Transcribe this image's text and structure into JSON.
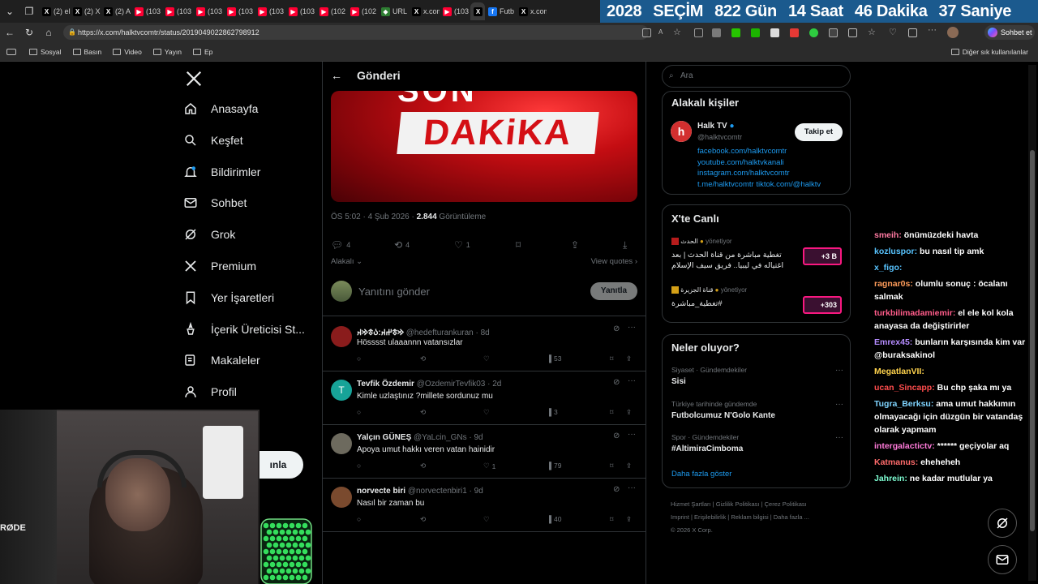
{
  "browser": {
    "tabs": [
      {
        "label": "(2) el",
        "icon": "x-logo-icon",
        "color": "#000000"
      },
      {
        "label": "(2) X",
        "icon": "x-logo-icon",
        "color": "#000000"
      },
      {
        "label": "(2) A",
        "icon": "x-logo-icon",
        "color": "#000000"
      },
      {
        "label": "(103",
        "icon": "youtube-icon",
        "color": "#ff0033"
      },
      {
        "label": "(103",
        "icon": "youtube-icon",
        "color": "#ff0033"
      },
      {
        "label": "(103",
        "icon": "youtube-icon",
        "color": "#ff0033"
      },
      {
        "label": "(103",
        "icon": "youtube-icon",
        "color": "#ff0033"
      },
      {
        "label": "(103",
        "icon": "youtube-icon",
        "color": "#ff0033"
      },
      {
        "label": "(103",
        "icon": "youtube-icon",
        "color": "#ff0033"
      },
      {
        "label": "(102",
        "icon": "youtube-icon",
        "color": "#ff0033"
      },
      {
        "label": "(102",
        "icon": "youtube-icon",
        "color": "#ff0033"
      },
      {
        "label": "URL",
        "icon": "shield-icon",
        "color": "#2e7d32"
      },
      {
        "label": "x.com",
        "icon": "x-logo-icon",
        "color": "#000000"
      },
      {
        "label": "(103",
        "icon": "youtube-icon",
        "color": "#ff0033"
      },
      {
        "label": "",
        "icon": "x-logo-icon",
        "color": "#000000",
        "active": true
      },
      {
        "label": "Futb",
        "icon": "facebook-icon",
        "color": "#1877f2"
      },
      {
        "label": "x.com",
        "icon": "x-logo-icon",
        "color": "#000000"
      }
    ],
    "url": "https://x.com/halktvcomtr/status/2019049022862798912",
    "copilot_label": "Sohbet et",
    "bookmarks": [
      "Sosyal",
      "Basın",
      "Video",
      "Yayın",
      "Ep"
    ],
    "other_bookmarks": "Diğer sık kullanılanlar"
  },
  "banner": {
    "year": "2028",
    "word": "SEÇİM",
    "days": "822 Gün",
    "hours": "14 Saat",
    "minutes": "46 Dakika",
    "seconds": "37 Saniye",
    "color": "#1b5a8e"
  },
  "sidebar": {
    "items": [
      {
        "label": "Anasayfa",
        "icon": "home-icon"
      },
      {
        "label": "Keşfet",
        "icon": "search-icon"
      },
      {
        "label": "Bildirimler",
        "icon": "bell-icon"
      },
      {
        "label": "Sohbet",
        "icon": "mail-icon"
      },
      {
        "label": "Grok",
        "icon": "grok-icon"
      },
      {
        "label": "Premium",
        "icon": "x-logo-icon"
      },
      {
        "label": "Yer İşaretleri",
        "icon": "bookmark-icon"
      },
      {
        "label": "İçerik Üreticisi St...",
        "icon": "creator-icon"
      },
      {
        "label": "Makaleler",
        "icon": "article-icon"
      },
      {
        "label": "Profil",
        "icon": "person-icon"
      }
    ],
    "post_button_fragment": "ınla"
  },
  "main": {
    "header_title": "Gönderi",
    "media": {
      "top_word": "SON",
      "big_word": "DAKiKA"
    },
    "meta": {
      "time": "ÖS 5:02 · 4 Şub 2026 · ",
      "views": "2.844",
      "views_label": " Görüntüleme"
    },
    "actions": {
      "replies": "4",
      "reposts": "4",
      "likes": "1"
    },
    "sort_label": "Alakalı",
    "view_quotes": "View quotes",
    "reply_placeholder": "Yanıtını gönder",
    "reply_button": "Yanıtla",
    "replies": [
      {
        "name": "𐰢𐱃𐰔𐰴:𐰉𐱃𐰢𐰴",
        "handle": "@hedefturankuran · 8d",
        "text": "Hösssst ulaaannn vatansızlar",
        "replies": "",
        "reposts": "",
        "likes": "",
        "views": "53",
        "avatar_color": "#8a1c1c"
      },
      {
        "name": "Tevfik Özdemir",
        "handle": "@OzdemirTevfik03 · 2d",
        "text": "Kimle uzlaştınız ?millete sordunuz mu",
        "replies": "",
        "reposts": "",
        "likes": "",
        "views": "3",
        "avatar_color": "#17a398",
        "avatar_letter": "T"
      },
      {
        "name": "Yalçın GÜNEŞ",
        "handle": "@YaLcin_GNs · 9d",
        "text": "Apoya umut hakkı veren vatan hainidir",
        "replies": "",
        "reposts": "",
        "likes": "1",
        "views": "79",
        "avatar_color": "#6d6a5e"
      },
      {
        "name": "norvecte biri",
        "handle": "@norvectenbiri1 · 9d",
        "text": "Nasıl bir zaman bu",
        "replies": "",
        "reposts": "",
        "likes": "",
        "views": "40",
        "avatar_color": "#7a4a2e"
      }
    ]
  },
  "right": {
    "search_placeholder": "Ara",
    "related": {
      "title": "Alakalı kişiler",
      "name": "Halk TV",
      "handle": "@halktvcomtr",
      "follow_label": "Takip et",
      "links": [
        "facebook.com/halktvcomtr",
        "youtube.com/halktvkanali",
        "instagram.com/halktvcomtr",
        "t.me/halktvcomtr tiktok.com/@halktv"
      ]
    },
    "live": {
      "title": "X'te Canlı",
      "items": [
        {
          "host": "الحدث",
          "status": "yönetiyor",
          "text": "تغطية مباشرة من قناة الحدث | بعد اغتياله في ليبيا.. فريق سيف الإسلام",
          "badge": "+3 B"
        },
        {
          "host": "قناة الجزيرة",
          "status": "yönetiyor",
          "text": "#تغطية_مباشرة",
          "badge": "+303"
        }
      ]
    },
    "trends": {
      "title": "Neler oluyor?",
      "items": [
        {
          "category": "Siyaset · Gündemdekiler",
          "title": "Sisi"
        },
        {
          "category": "Türkiye tarihinde gündemde",
          "title": "Futbolcumuz N'Golo Kante"
        },
        {
          "category": "Spor · Gündemdekiler",
          "title": "#AltimiraCimboma"
        }
      ],
      "more": "Daha fazla göster"
    },
    "footer": {
      "line1": [
        "Hizmet Şartları",
        "Gizlilik Politikası",
        "Çerez Politikası"
      ],
      "line2": [
        "Imprint",
        "Erişilebilirlik",
        "Reklam bilgisi",
        "Daha fazla ..."
      ],
      "copyright": "© 2026 X Corp."
    }
  },
  "chat": [
    {
      "user": "smeih:",
      "text": " önümüzdeki havta",
      "color": "#ff7aa2"
    },
    {
      "user": "kozluspor:",
      "text": " bu nasıl tip amk",
      "color": "#58c4ff"
    },
    {
      "user": "x_figo:",
      "text": "",
      "color": "#58c4ff"
    },
    {
      "user": "ragnar0s:",
      "text": " olumlu sonuç : öcalanı salmak",
      "color": "#ff9c5a"
    },
    {
      "user": "turkbilimadamiemir:",
      "text": " el ele kol kola anayasa da değiştirirler",
      "color": "#ff5c8a"
    },
    {
      "user": "Emrex45:",
      "text": " bunların karşısında kim var @buraksakinol",
      "color": "#b58cff"
    },
    {
      "user": "MegatlanVII:",
      "text": "",
      "color": "#ffd34d"
    },
    {
      "user": "ucan_Sincapp:",
      "text": " Bu chp şaka mı ya",
      "color": "#ff4d4d"
    },
    {
      "user": "Tugra_Berksu:",
      "text": " ama umut hakkımın olmayacağı için düzgün bir vatandaş olarak yapmam",
      "color": "#7fd4ff"
    },
    {
      "user": "intergalactictv:",
      "text": " ****** geçiyolar aq",
      "color": "#ff7ad9"
    },
    {
      "user": "Katmanus:",
      "text": " eheheheh",
      "color": "#ff6b6b"
    },
    {
      "user": "Jahrein:",
      "text": " ne kadar mutlular ya",
      "color": "#7fffd4"
    }
  ],
  "webcam": {
    "mic_brand": "RØDE"
  }
}
